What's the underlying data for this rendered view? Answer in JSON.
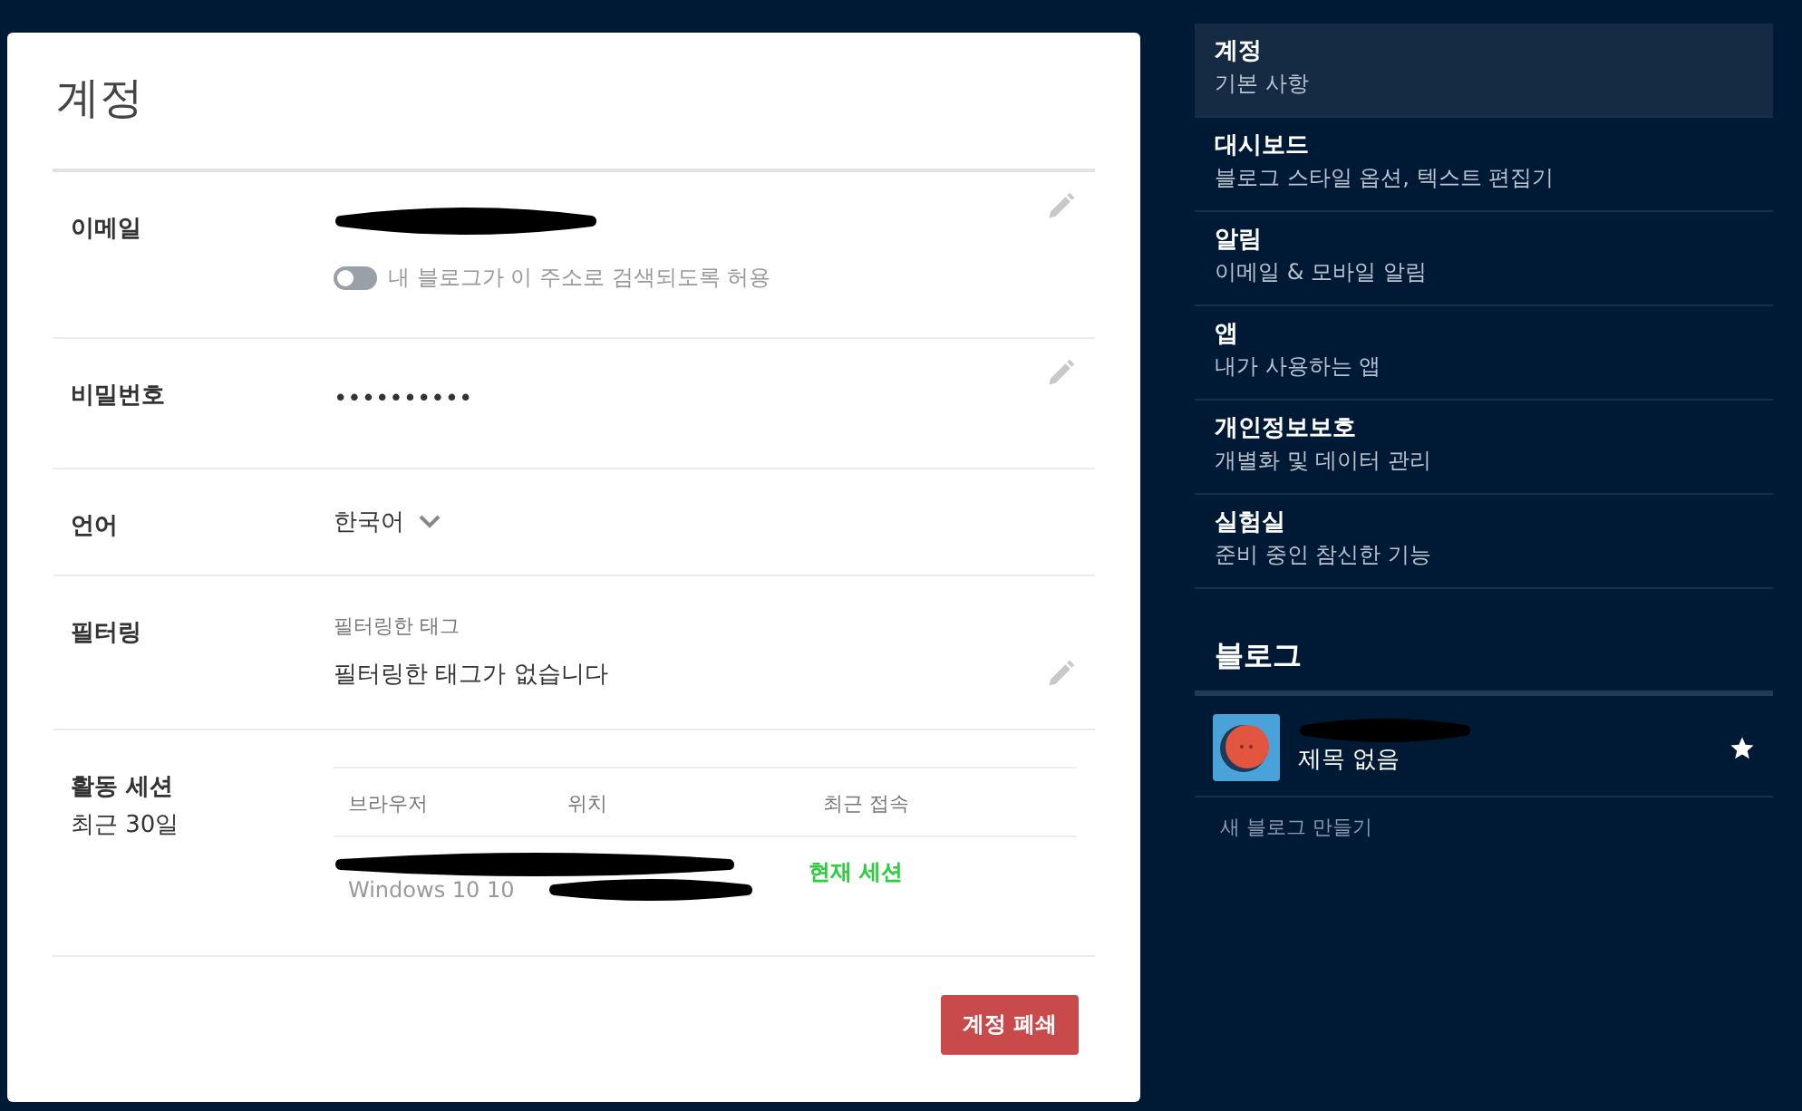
{
  "account": {
    "title": "계정",
    "email": {
      "label": "이메일",
      "toggle": {
        "label": "내 블로그가 이 주소로 검색되도록 허용",
        "on": false
      }
    },
    "password": {
      "label": "비밀번호",
      "value": "••••••••••"
    },
    "language": {
      "label": "언어",
      "value": "한국어"
    },
    "filtering": {
      "label": "필터링",
      "caption": "필터링한 태그",
      "value": "필터링한 태그가 없습니다"
    },
    "sessions": {
      "label": "활동 세션",
      "sublabel": "최근 30일",
      "columns": [
        "브라우저",
        "위치",
        "최근 접속"
      ],
      "rows": [
        {
          "browser_detail": "Windows 10 10",
          "status": "현재 세션"
        }
      ]
    },
    "delete_button": "계정 폐쇄"
  },
  "sidebar": {
    "items": [
      {
        "title": "계정",
        "subtitle": "기본 사항",
        "selected": true
      },
      {
        "title": "대시보드",
        "subtitle": "블로그 스타일 옵션, 텍스트 편집기",
        "selected": false
      },
      {
        "title": "알림",
        "subtitle": "이메일 & 모바일 알림",
        "selected": false
      },
      {
        "title": "앱",
        "subtitle": "내가 사용하는 앱",
        "selected": false
      },
      {
        "title": "개인정보보호",
        "subtitle": "개별화 및 데이터 관리",
        "selected": false
      },
      {
        "title": "실험실",
        "subtitle": "준비 중인 참신한 기능",
        "selected": false
      }
    ],
    "blogs_heading": "블로그",
    "blogs": [
      {
        "subtitle": "제목 없음",
        "starred": true
      }
    ],
    "new_blog": "새 블로그 만들기"
  }
}
